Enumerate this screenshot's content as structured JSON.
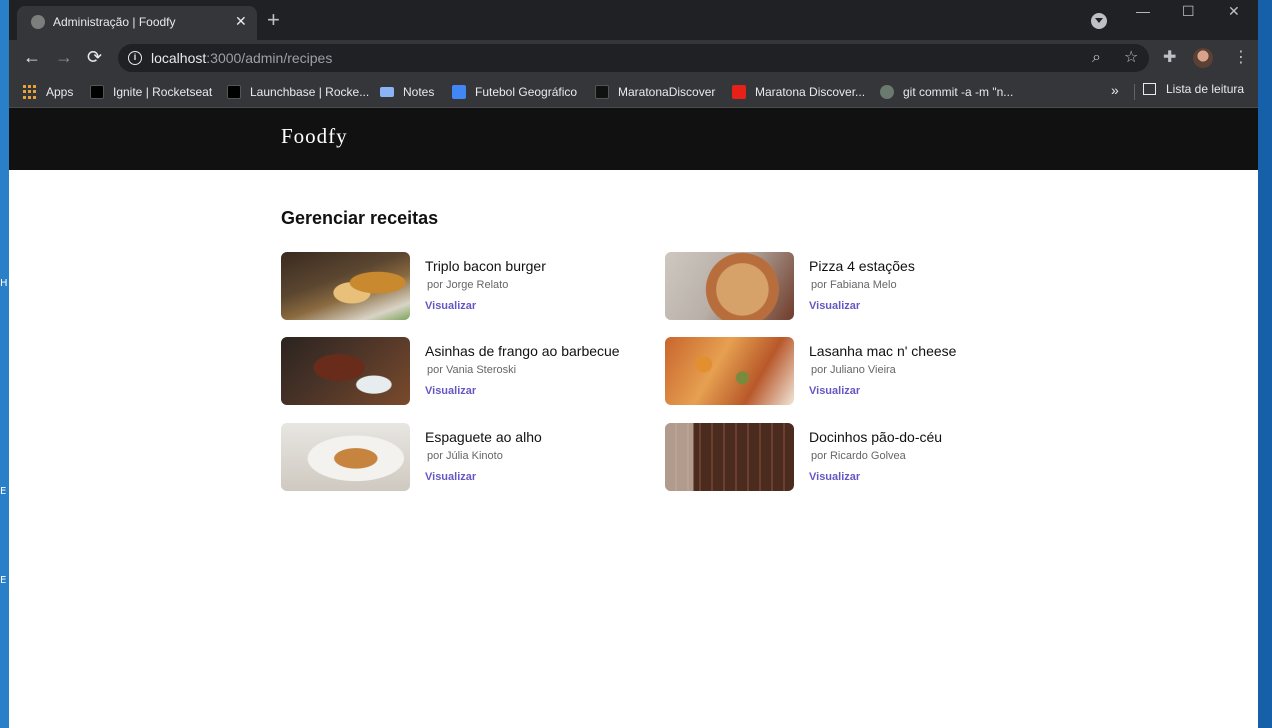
{
  "browser": {
    "tab": {
      "title": "Administração | Foodfy",
      "close_glyph": "✕"
    },
    "new_tab_glyph": "+",
    "window_controls": {
      "minimize": "—",
      "maximize": "☐",
      "close": "✕"
    },
    "nav": {
      "back": "←",
      "forward": "→",
      "reload": "⟳"
    },
    "address": {
      "host": "localhost",
      "path": ":3000/admin/recipes"
    },
    "bookmarks": [
      {
        "label": "Apps",
        "icon": "apps-grid-icon"
      },
      {
        "label": "Ignite | Rocketseat",
        "icon": "rocketseat-icon"
      },
      {
        "label": "Launchbase | Rocke...",
        "icon": "rocketseat-icon"
      },
      {
        "label": "Notes",
        "icon": "laptop-icon"
      },
      {
        "label": "Futebol Geográfico",
        "icon": "docs-icon"
      },
      {
        "label": "MaratonaDiscover",
        "icon": "info-icon"
      },
      {
        "label": "Maratona Discover...",
        "icon": "youtube-icon"
      },
      {
        "label": "git commit -a -m \"n...",
        "icon": "git-icon"
      }
    ],
    "bookmarks_more": "»",
    "reading_list": "Lista de leitura"
  },
  "site": {
    "logo": "Foodfy",
    "page_title": "Gerenciar receitas",
    "recipes": [
      {
        "title": "Triplo bacon burger",
        "author": "por Jorge Relato",
        "link": "Visualizar"
      },
      {
        "title": "Pizza 4 estações",
        "author": "por Fabiana Melo",
        "link": "Visualizar"
      },
      {
        "title": "Asinhas de frango ao barbecue",
        "author": "por Vania Steroski",
        "link": "Visualizar"
      },
      {
        "title": "Lasanha mac n' cheese",
        "author": "por Juliano Vieira",
        "link": "Visualizar"
      },
      {
        "title": "Espaguete ao alho",
        "author": "por Júlia Kinoto",
        "link": "Visualizar"
      },
      {
        "title": "Docinhos pão-do-céu",
        "author": "por Ricardo Golvea",
        "link": "Visualizar"
      }
    ]
  },
  "colors": {
    "header_bg": "#111111",
    "link": "#6558c3",
    "chrome_dark": "#202124",
    "chrome_toolbar": "#35363a"
  }
}
